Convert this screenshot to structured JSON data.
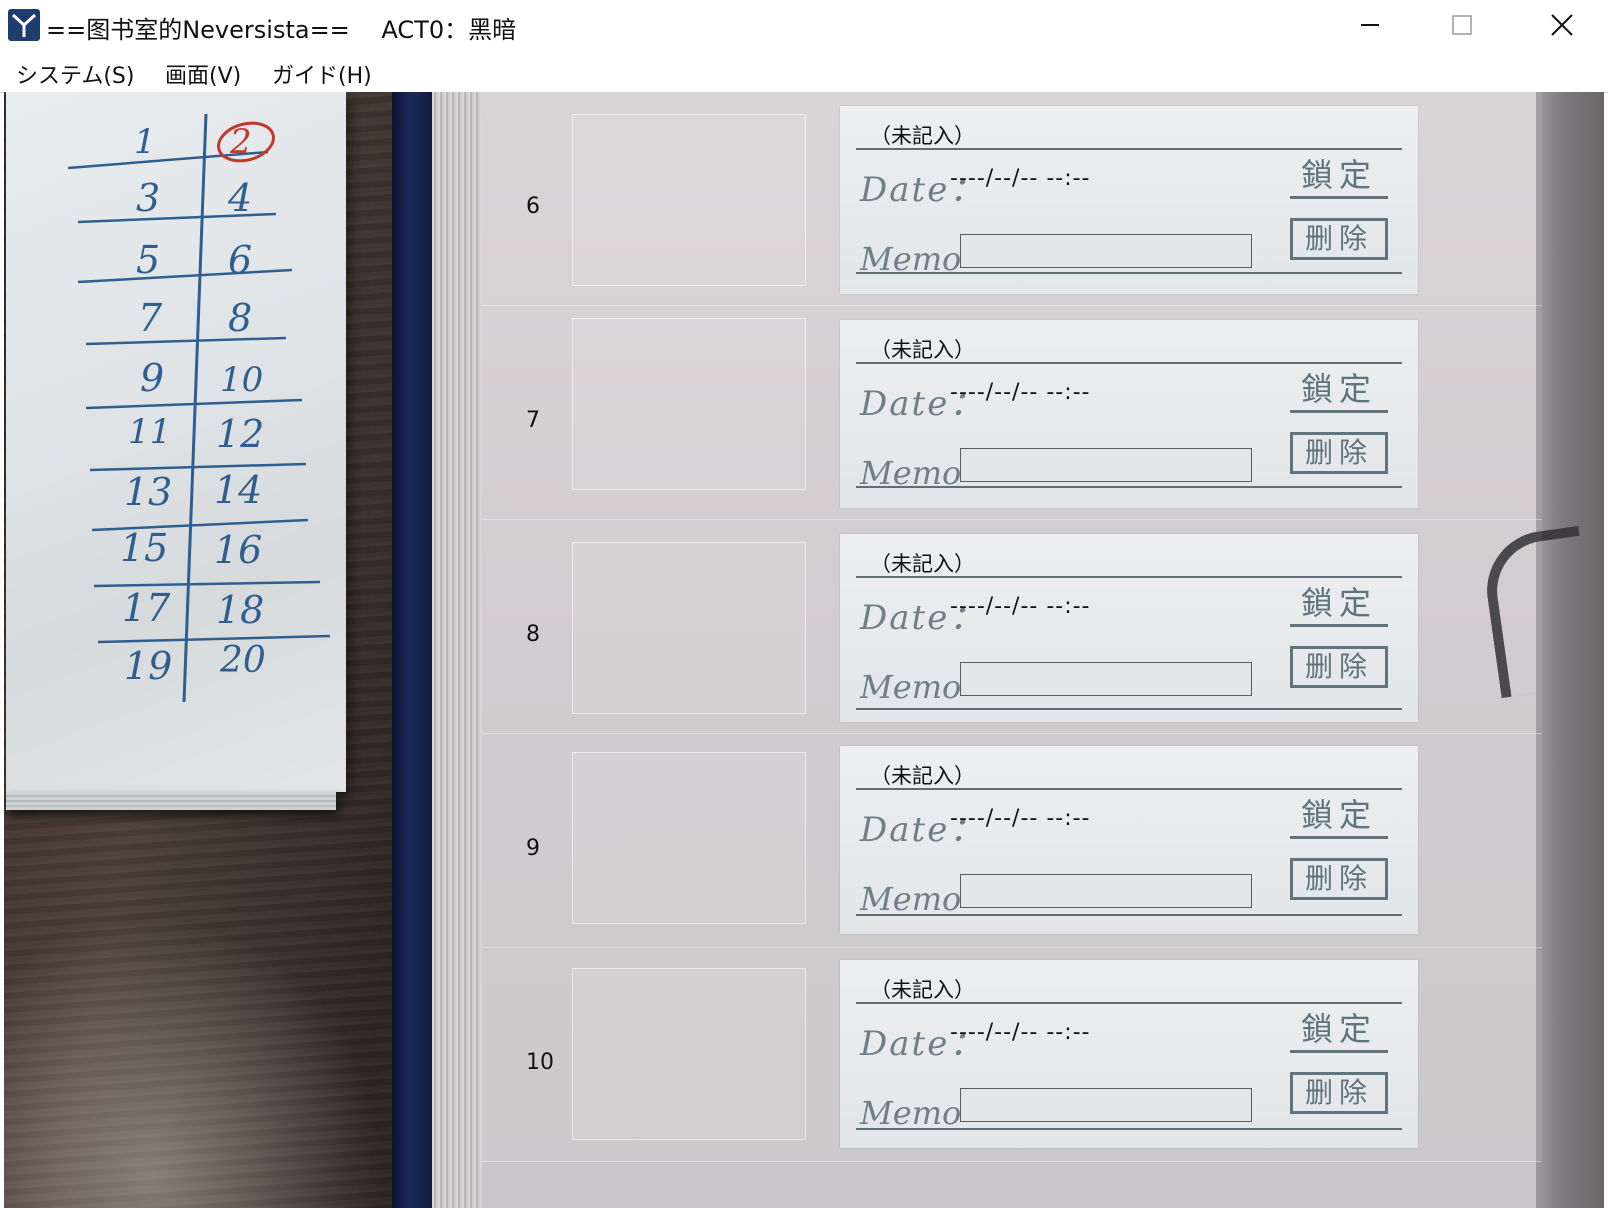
{
  "window": {
    "title": "==图书室的Neversista==　 ACT0：黑暗",
    "controls": {
      "minimize": "minimize-icon",
      "maximize": "maximize-icon",
      "close": "close-icon"
    }
  },
  "menu": [
    {
      "label": "システム(S)"
    },
    {
      "label": "画面(V)"
    },
    {
      "label": "ガイド(H)"
    }
  ],
  "notepad": {
    "numbers": [
      "1",
      "2",
      "3",
      "4",
      "5",
      "6",
      "7",
      "8",
      "9",
      "10",
      "11",
      "12",
      "13",
      "14",
      "15",
      "16",
      "17",
      "18",
      "19",
      "20"
    ],
    "current_page": "2"
  },
  "save_slots": [
    {
      "number": "6",
      "title": "（未記入）",
      "date_label": "Date：",
      "date": "----/--/-- --:--",
      "memo_label": "Memo",
      "memo": "",
      "lock_label": "鎖定",
      "delete_label": "删除"
    },
    {
      "number": "7",
      "title": "（未記入）",
      "date_label": "Date：",
      "date": "----/--/-- --:--",
      "memo_label": "Memo",
      "memo": "",
      "lock_label": "鎖定",
      "delete_label": "删除"
    },
    {
      "number": "8",
      "title": "（未記入）",
      "date_label": "Date：",
      "date": "----/--/-- --:--",
      "memo_label": "Memo",
      "memo": "",
      "lock_label": "鎖定",
      "delete_label": "删除"
    },
    {
      "number": "9",
      "title": "（未記入）",
      "date_label": "Date：",
      "date": "----/--/-- --:--",
      "memo_label": "Memo",
      "memo": "",
      "lock_label": "鎖定",
      "delete_label": "删除"
    },
    {
      "number": "10",
      "title": "（未記入）",
      "date_label": "Date：",
      "date": "----/--/-- --:--",
      "memo_label": "Memo",
      "memo": "",
      "lock_label": "鎖定",
      "delete_label": "删除"
    }
  ]
}
